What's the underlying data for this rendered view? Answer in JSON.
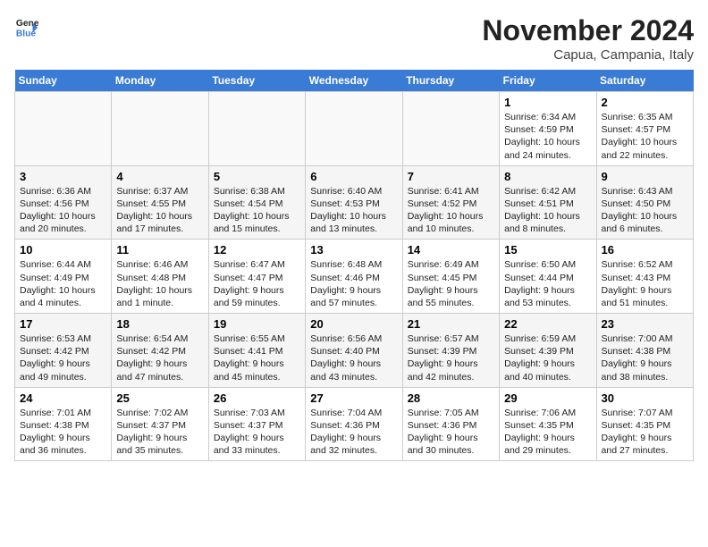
{
  "header": {
    "logo_line1": "General",
    "logo_line2": "Blue",
    "month": "November 2024",
    "location": "Capua, Campania, Italy"
  },
  "weekdays": [
    "Sunday",
    "Monday",
    "Tuesday",
    "Wednesday",
    "Thursday",
    "Friday",
    "Saturday"
  ],
  "weeks": [
    [
      {
        "day": "",
        "info": ""
      },
      {
        "day": "",
        "info": ""
      },
      {
        "day": "",
        "info": ""
      },
      {
        "day": "",
        "info": ""
      },
      {
        "day": "",
        "info": ""
      },
      {
        "day": "1",
        "info": "Sunrise: 6:34 AM\nSunset: 4:59 PM\nDaylight: 10 hours and 24 minutes."
      },
      {
        "day": "2",
        "info": "Sunrise: 6:35 AM\nSunset: 4:57 PM\nDaylight: 10 hours and 22 minutes."
      }
    ],
    [
      {
        "day": "3",
        "info": "Sunrise: 6:36 AM\nSunset: 4:56 PM\nDaylight: 10 hours and 20 minutes."
      },
      {
        "day": "4",
        "info": "Sunrise: 6:37 AM\nSunset: 4:55 PM\nDaylight: 10 hours and 17 minutes."
      },
      {
        "day": "5",
        "info": "Sunrise: 6:38 AM\nSunset: 4:54 PM\nDaylight: 10 hours and 15 minutes."
      },
      {
        "day": "6",
        "info": "Sunrise: 6:40 AM\nSunset: 4:53 PM\nDaylight: 10 hours and 13 minutes."
      },
      {
        "day": "7",
        "info": "Sunrise: 6:41 AM\nSunset: 4:52 PM\nDaylight: 10 hours and 10 minutes."
      },
      {
        "day": "8",
        "info": "Sunrise: 6:42 AM\nSunset: 4:51 PM\nDaylight: 10 hours and 8 minutes."
      },
      {
        "day": "9",
        "info": "Sunrise: 6:43 AM\nSunset: 4:50 PM\nDaylight: 10 hours and 6 minutes."
      }
    ],
    [
      {
        "day": "10",
        "info": "Sunrise: 6:44 AM\nSunset: 4:49 PM\nDaylight: 10 hours and 4 minutes."
      },
      {
        "day": "11",
        "info": "Sunrise: 6:46 AM\nSunset: 4:48 PM\nDaylight: 10 hours and 1 minute."
      },
      {
        "day": "12",
        "info": "Sunrise: 6:47 AM\nSunset: 4:47 PM\nDaylight: 9 hours and 59 minutes."
      },
      {
        "day": "13",
        "info": "Sunrise: 6:48 AM\nSunset: 4:46 PM\nDaylight: 9 hours and 57 minutes."
      },
      {
        "day": "14",
        "info": "Sunrise: 6:49 AM\nSunset: 4:45 PM\nDaylight: 9 hours and 55 minutes."
      },
      {
        "day": "15",
        "info": "Sunrise: 6:50 AM\nSunset: 4:44 PM\nDaylight: 9 hours and 53 minutes."
      },
      {
        "day": "16",
        "info": "Sunrise: 6:52 AM\nSunset: 4:43 PM\nDaylight: 9 hours and 51 minutes."
      }
    ],
    [
      {
        "day": "17",
        "info": "Sunrise: 6:53 AM\nSunset: 4:42 PM\nDaylight: 9 hours and 49 minutes."
      },
      {
        "day": "18",
        "info": "Sunrise: 6:54 AM\nSunset: 4:42 PM\nDaylight: 9 hours and 47 minutes."
      },
      {
        "day": "19",
        "info": "Sunrise: 6:55 AM\nSunset: 4:41 PM\nDaylight: 9 hours and 45 minutes."
      },
      {
        "day": "20",
        "info": "Sunrise: 6:56 AM\nSunset: 4:40 PM\nDaylight: 9 hours and 43 minutes."
      },
      {
        "day": "21",
        "info": "Sunrise: 6:57 AM\nSunset: 4:39 PM\nDaylight: 9 hours and 42 minutes."
      },
      {
        "day": "22",
        "info": "Sunrise: 6:59 AM\nSunset: 4:39 PM\nDaylight: 9 hours and 40 minutes."
      },
      {
        "day": "23",
        "info": "Sunrise: 7:00 AM\nSunset: 4:38 PM\nDaylight: 9 hours and 38 minutes."
      }
    ],
    [
      {
        "day": "24",
        "info": "Sunrise: 7:01 AM\nSunset: 4:38 PM\nDaylight: 9 hours and 36 minutes."
      },
      {
        "day": "25",
        "info": "Sunrise: 7:02 AM\nSunset: 4:37 PM\nDaylight: 9 hours and 35 minutes."
      },
      {
        "day": "26",
        "info": "Sunrise: 7:03 AM\nSunset: 4:37 PM\nDaylight: 9 hours and 33 minutes."
      },
      {
        "day": "27",
        "info": "Sunrise: 7:04 AM\nSunset: 4:36 PM\nDaylight: 9 hours and 32 minutes."
      },
      {
        "day": "28",
        "info": "Sunrise: 7:05 AM\nSunset: 4:36 PM\nDaylight: 9 hours and 30 minutes."
      },
      {
        "day": "29",
        "info": "Sunrise: 7:06 AM\nSunset: 4:35 PM\nDaylight: 9 hours and 29 minutes."
      },
      {
        "day": "30",
        "info": "Sunrise: 7:07 AM\nSunset: 4:35 PM\nDaylight: 9 hours and 27 minutes."
      }
    ]
  ]
}
